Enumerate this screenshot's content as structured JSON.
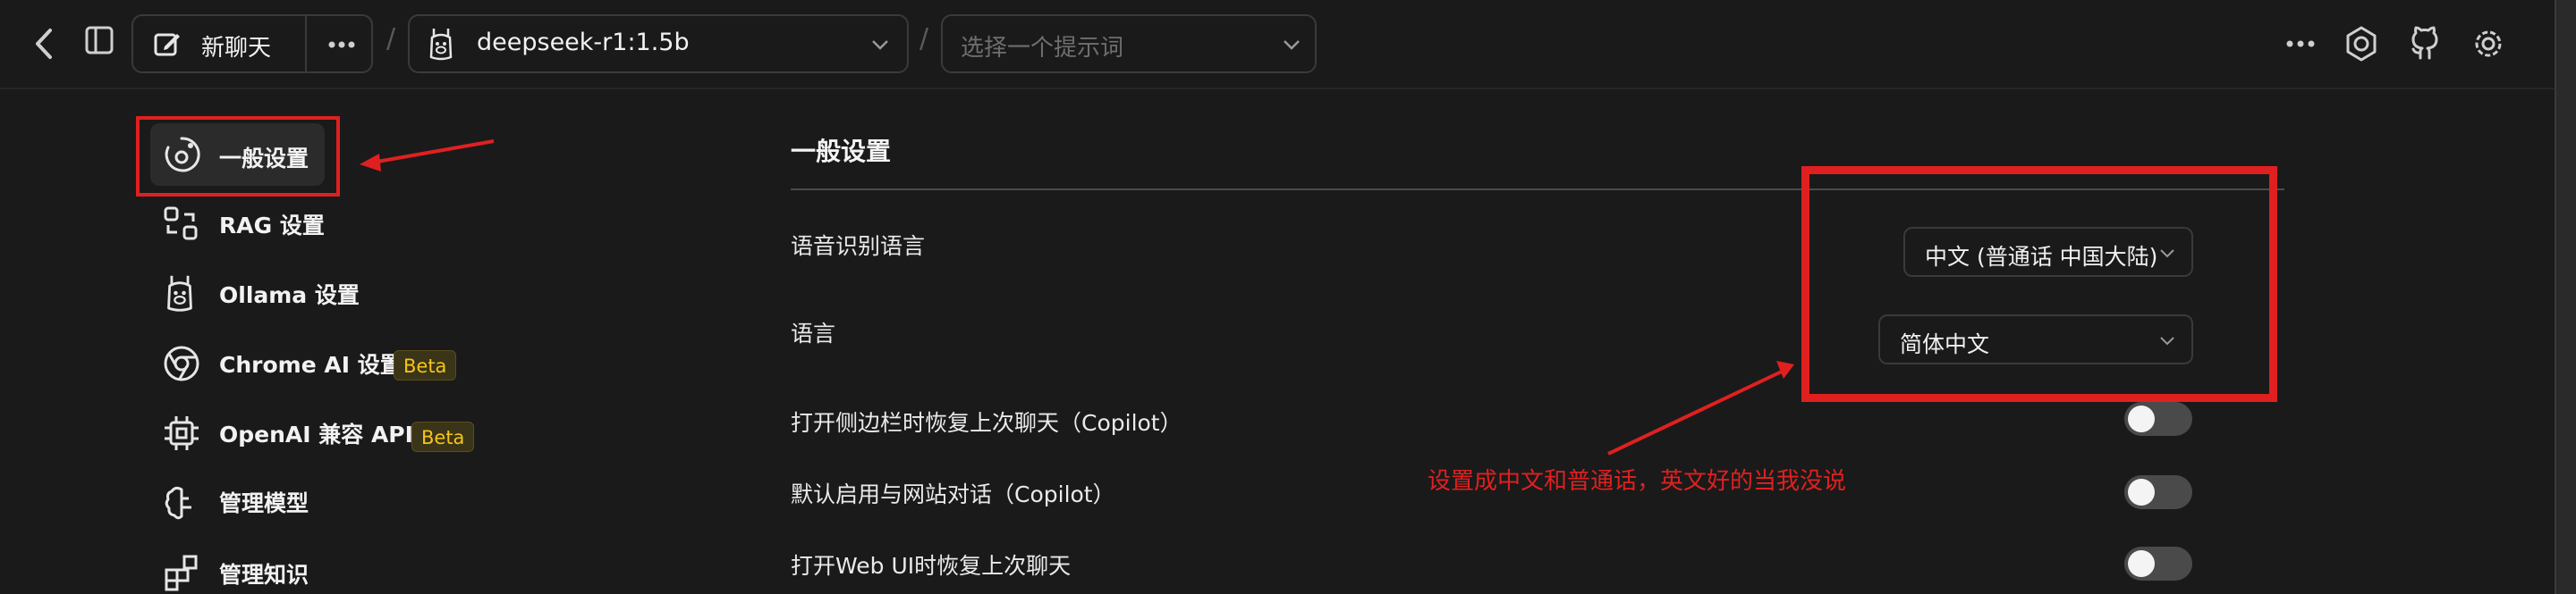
{
  "topbar": {
    "new_chat_label": "新聊天",
    "model_name": "deepseek-r1:1.5b",
    "prompt_placeholder": "选择一个提示词",
    "separator": "/"
  },
  "sidebar": {
    "items": [
      {
        "label": "一般设置",
        "icon": "settings-ring-icon"
      },
      {
        "label": "RAG 设置",
        "icon": "rag-icon"
      },
      {
        "label": "Ollama 设置",
        "icon": "llama-icon"
      },
      {
        "label": "Chrome AI 设置",
        "icon": "chrome-icon",
        "badge": "Beta"
      },
      {
        "label": "OpenAI 兼容 API",
        "icon": "chip-icon",
        "badge": "Beta"
      },
      {
        "label": "管理模型",
        "icon": "brain-icon"
      },
      {
        "label": "管理知识",
        "icon": "blocks-icon"
      }
    ]
  },
  "main": {
    "section_title": "一般设置",
    "speech_lang_label": "语音识别语言",
    "speech_lang_value": "中文 (普通话 中国大陆)",
    "language_label": "语言",
    "language_value": "简体中文",
    "toggles": [
      {
        "label": "打开侧边栏时恢复上次聊天（Copilot）",
        "on": false
      },
      {
        "label": "默认启用与网站对话（Copilot）",
        "on": false
      },
      {
        "label": "打开Web UI时恢复上次聊天",
        "on": false
      }
    ]
  },
  "annotation": {
    "note": "设置成中文和普通话，英文好的当我没说",
    "color": "#e02020"
  },
  "colors": {
    "background": "#1a1a1a",
    "badge_text": "#f5c518",
    "annotation_red": "#e02020"
  }
}
